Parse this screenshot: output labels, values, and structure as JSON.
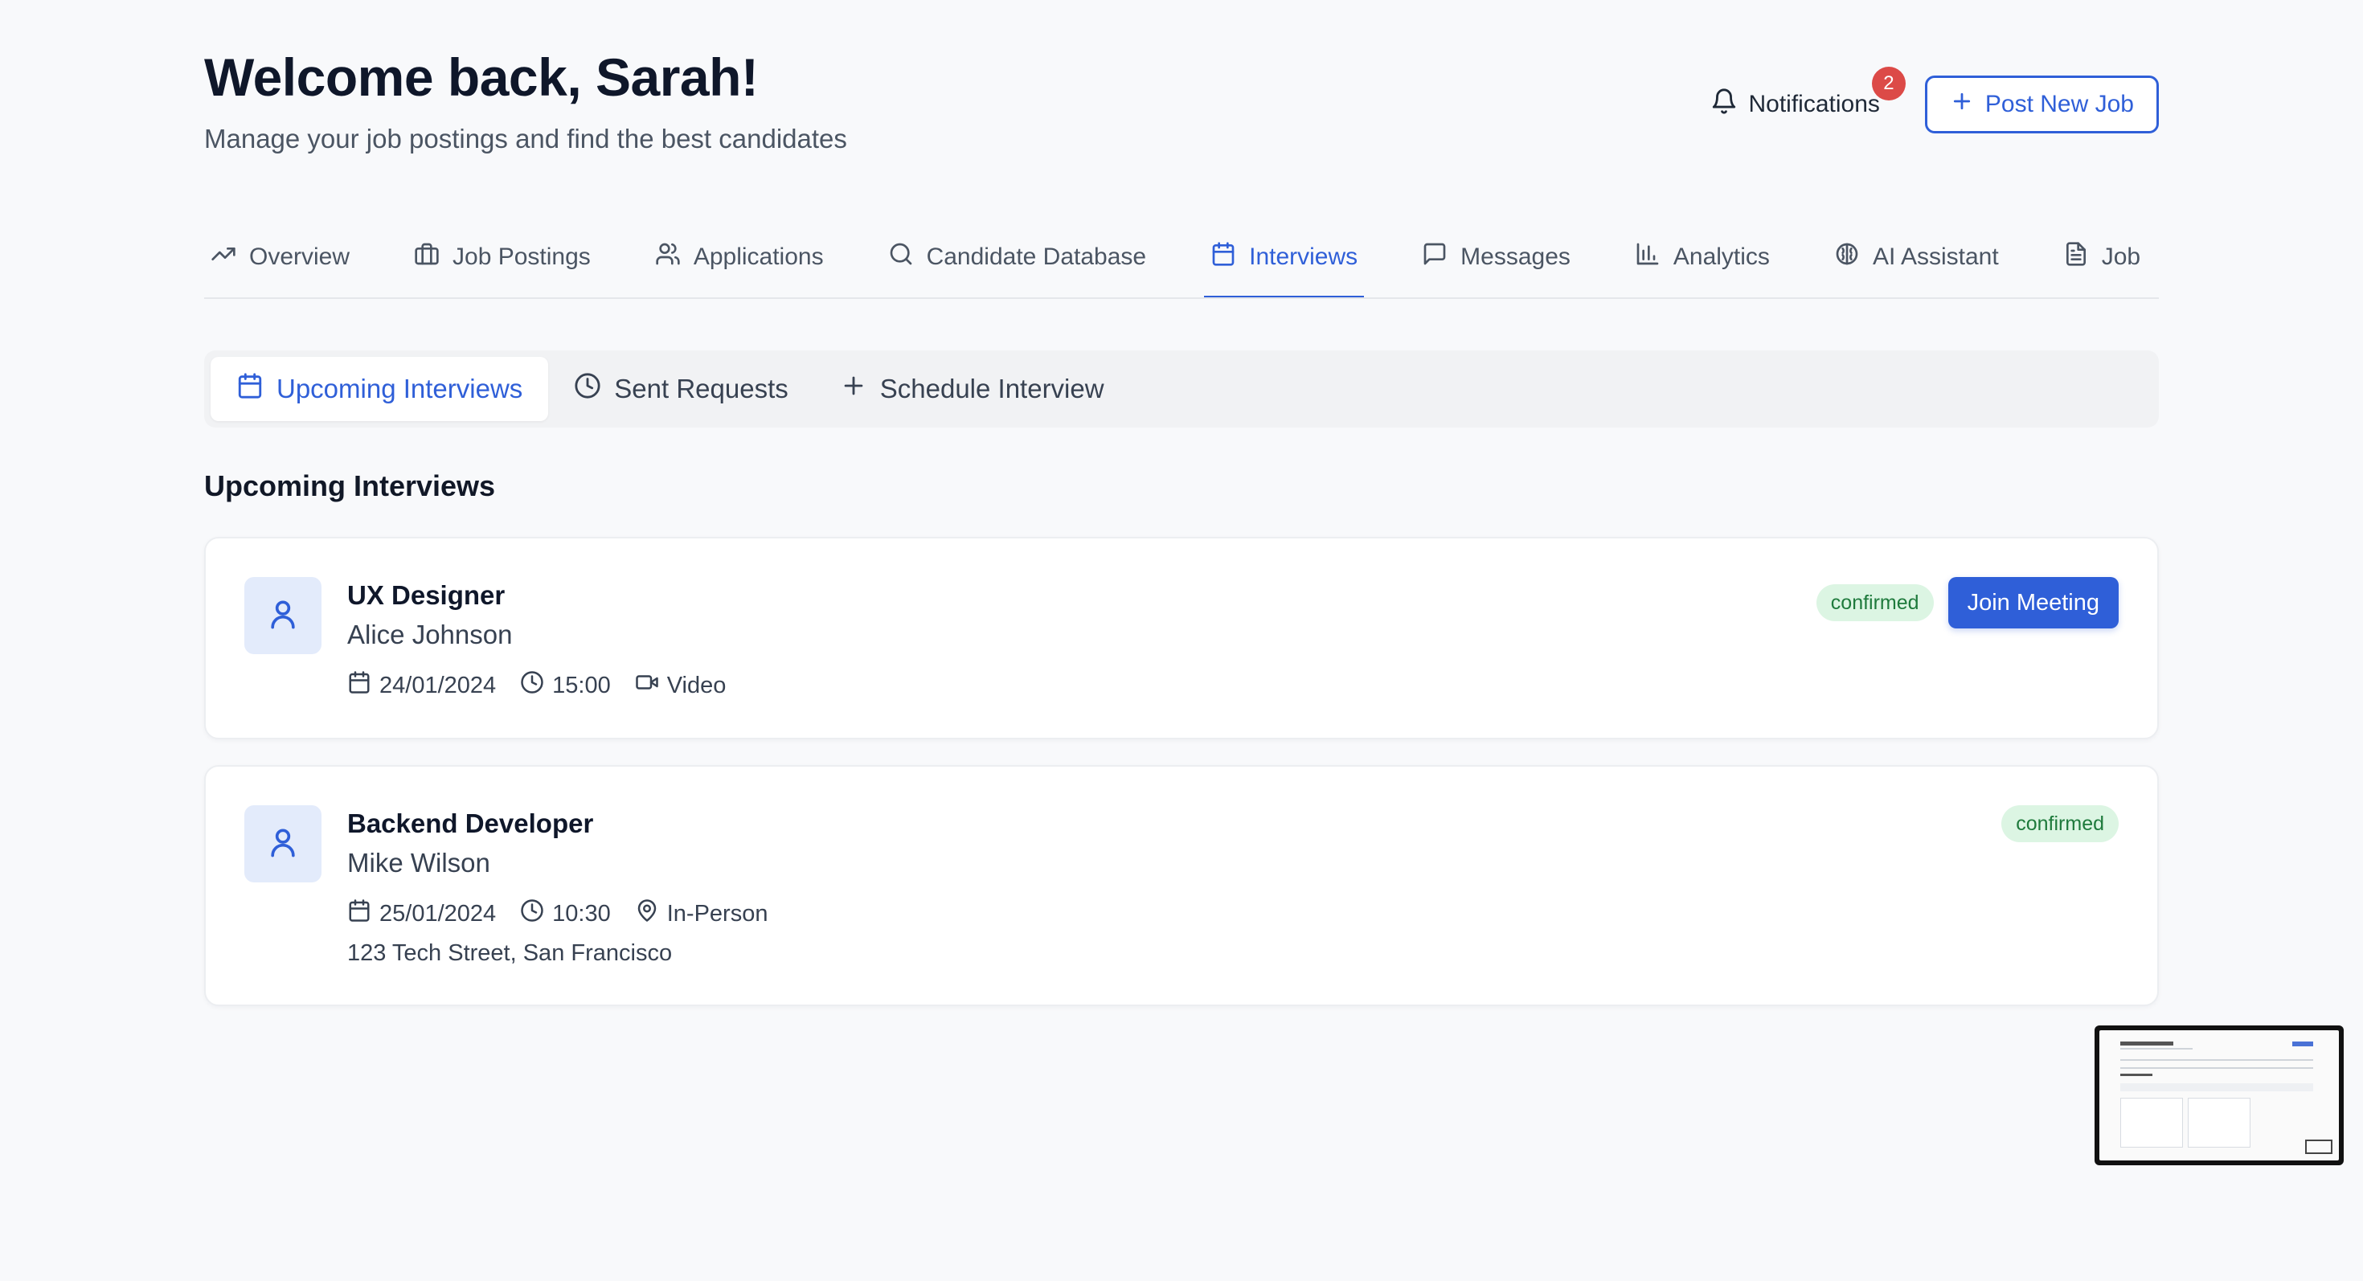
{
  "header": {
    "title": "Welcome back, Sarah!",
    "subtitle": "Manage your job postings and find the best candidates",
    "notifications_label": "Notifications",
    "notifications_count": "2",
    "post_job_label": "Post New Job"
  },
  "main_tabs": [
    {
      "label": "Overview",
      "icon": "trending-up-icon"
    },
    {
      "label": "Job Postings",
      "icon": "briefcase-icon"
    },
    {
      "label": "Applications",
      "icon": "users-icon"
    },
    {
      "label": "Candidate Database",
      "icon": "search-icon"
    },
    {
      "label": "Interviews",
      "icon": "calendar-icon",
      "active": true
    },
    {
      "label": "Messages",
      "icon": "message-icon"
    },
    {
      "label": "Analytics",
      "icon": "bar-chart-icon"
    },
    {
      "label": "AI Assistant",
      "icon": "brain-icon"
    },
    {
      "label": "Job",
      "icon": "file-icon"
    }
  ],
  "sub_tabs": [
    {
      "label": "Upcoming Interviews",
      "icon": "calendar-icon",
      "active": true
    },
    {
      "label": "Sent Requests",
      "icon": "clock-icon"
    },
    {
      "label": "Schedule Interview",
      "icon": "plus-icon"
    }
  ],
  "section_title": "Upcoming Interviews",
  "interviews": [
    {
      "job_title": "UX Designer",
      "candidate": "Alice Johnson",
      "date": "24/01/2024",
      "time": "15:00",
      "type": "Video",
      "status": "confirmed",
      "action_label": "Join Meeting"
    },
    {
      "job_title": "Backend Developer",
      "candidate": "Mike Wilson",
      "date": "25/01/2024",
      "time": "10:30",
      "type": "In-Person",
      "location": "123 Tech Street, San Francisco",
      "status": "confirmed"
    }
  ],
  "colors": {
    "accent": "#2f5fd8",
    "badge_red": "#dc4a47",
    "status_bg": "#dcf5e3",
    "status_text": "#1e7a3c"
  }
}
